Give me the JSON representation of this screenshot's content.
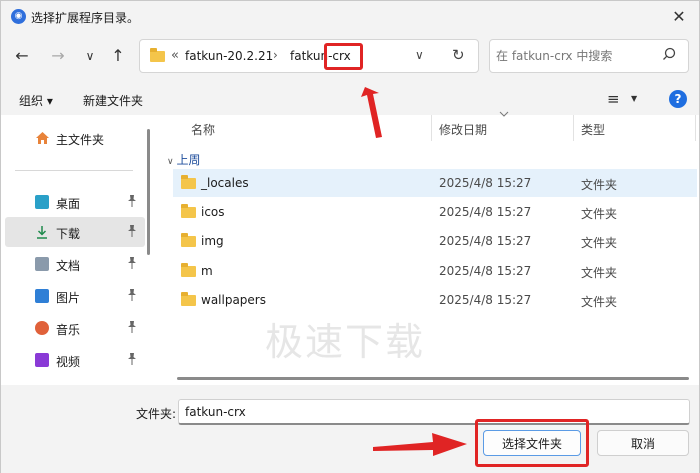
{
  "window": {
    "title": "选择扩展程序目录。",
    "close_glyph": "✕"
  },
  "nav": {
    "back": "←",
    "forward": "→",
    "recent": "∨",
    "up": "↑",
    "breadcrumb_prefix": "«",
    "breadcrumb": [
      "fatkun-20.2.21",
      "fatkun-crx"
    ],
    "breadcrumb_sep": "›",
    "dropdown": "∨",
    "refresh": "↻"
  },
  "search": {
    "placeholder": "在 fatkun-crx 中搜索"
  },
  "toolbar": {
    "organize": "组织 ▾",
    "new_folder": "新建文件夹",
    "view_glyph": "≡",
    "view_arrow": "▼",
    "help": "?"
  },
  "sidebar": {
    "home": "主文件夹",
    "items": [
      {
        "label": "桌面",
        "color": "#2aa0c8"
      },
      {
        "label": "下载",
        "color": "#1f8a4c"
      },
      {
        "label": "文档",
        "color": "#6a7b8c"
      },
      {
        "label": "图片",
        "color": "#2f7fd6"
      },
      {
        "label": "音乐",
        "color": "#e0613a"
      },
      {
        "label": "视频",
        "color": "#8a3ad6"
      }
    ],
    "pin_glyph": "📌"
  },
  "columns": {
    "name": "名称",
    "date": "修改日期",
    "type": "类型"
  },
  "group": "上周",
  "files": [
    {
      "name": "_locales",
      "date": "2025/4/8 15:27",
      "type": "文件夹"
    },
    {
      "name": "icos",
      "date": "2025/4/8 15:27",
      "type": "文件夹"
    },
    {
      "name": "img",
      "date": "2025/4/8 15:27",
      "type": "文件夹"
    },
    {
      "name": "m",
      "date": "2025/4/8 15:27",
      "type": "文件夹"
    },
    {
      "name": "wallpapers",
      "date": "2025/4/8 15:27",
      "type": "文件夹"
    }
  ],
  "watermark": "极速下载",
  "footer": {
    "folder_label": "文件夹:",
    "folder_value": "fatkun-crx",
    "select_button": "选择文件夹",
    "cancel_button": "取消"
  },
  "annotation_color": "#e02424"
}
